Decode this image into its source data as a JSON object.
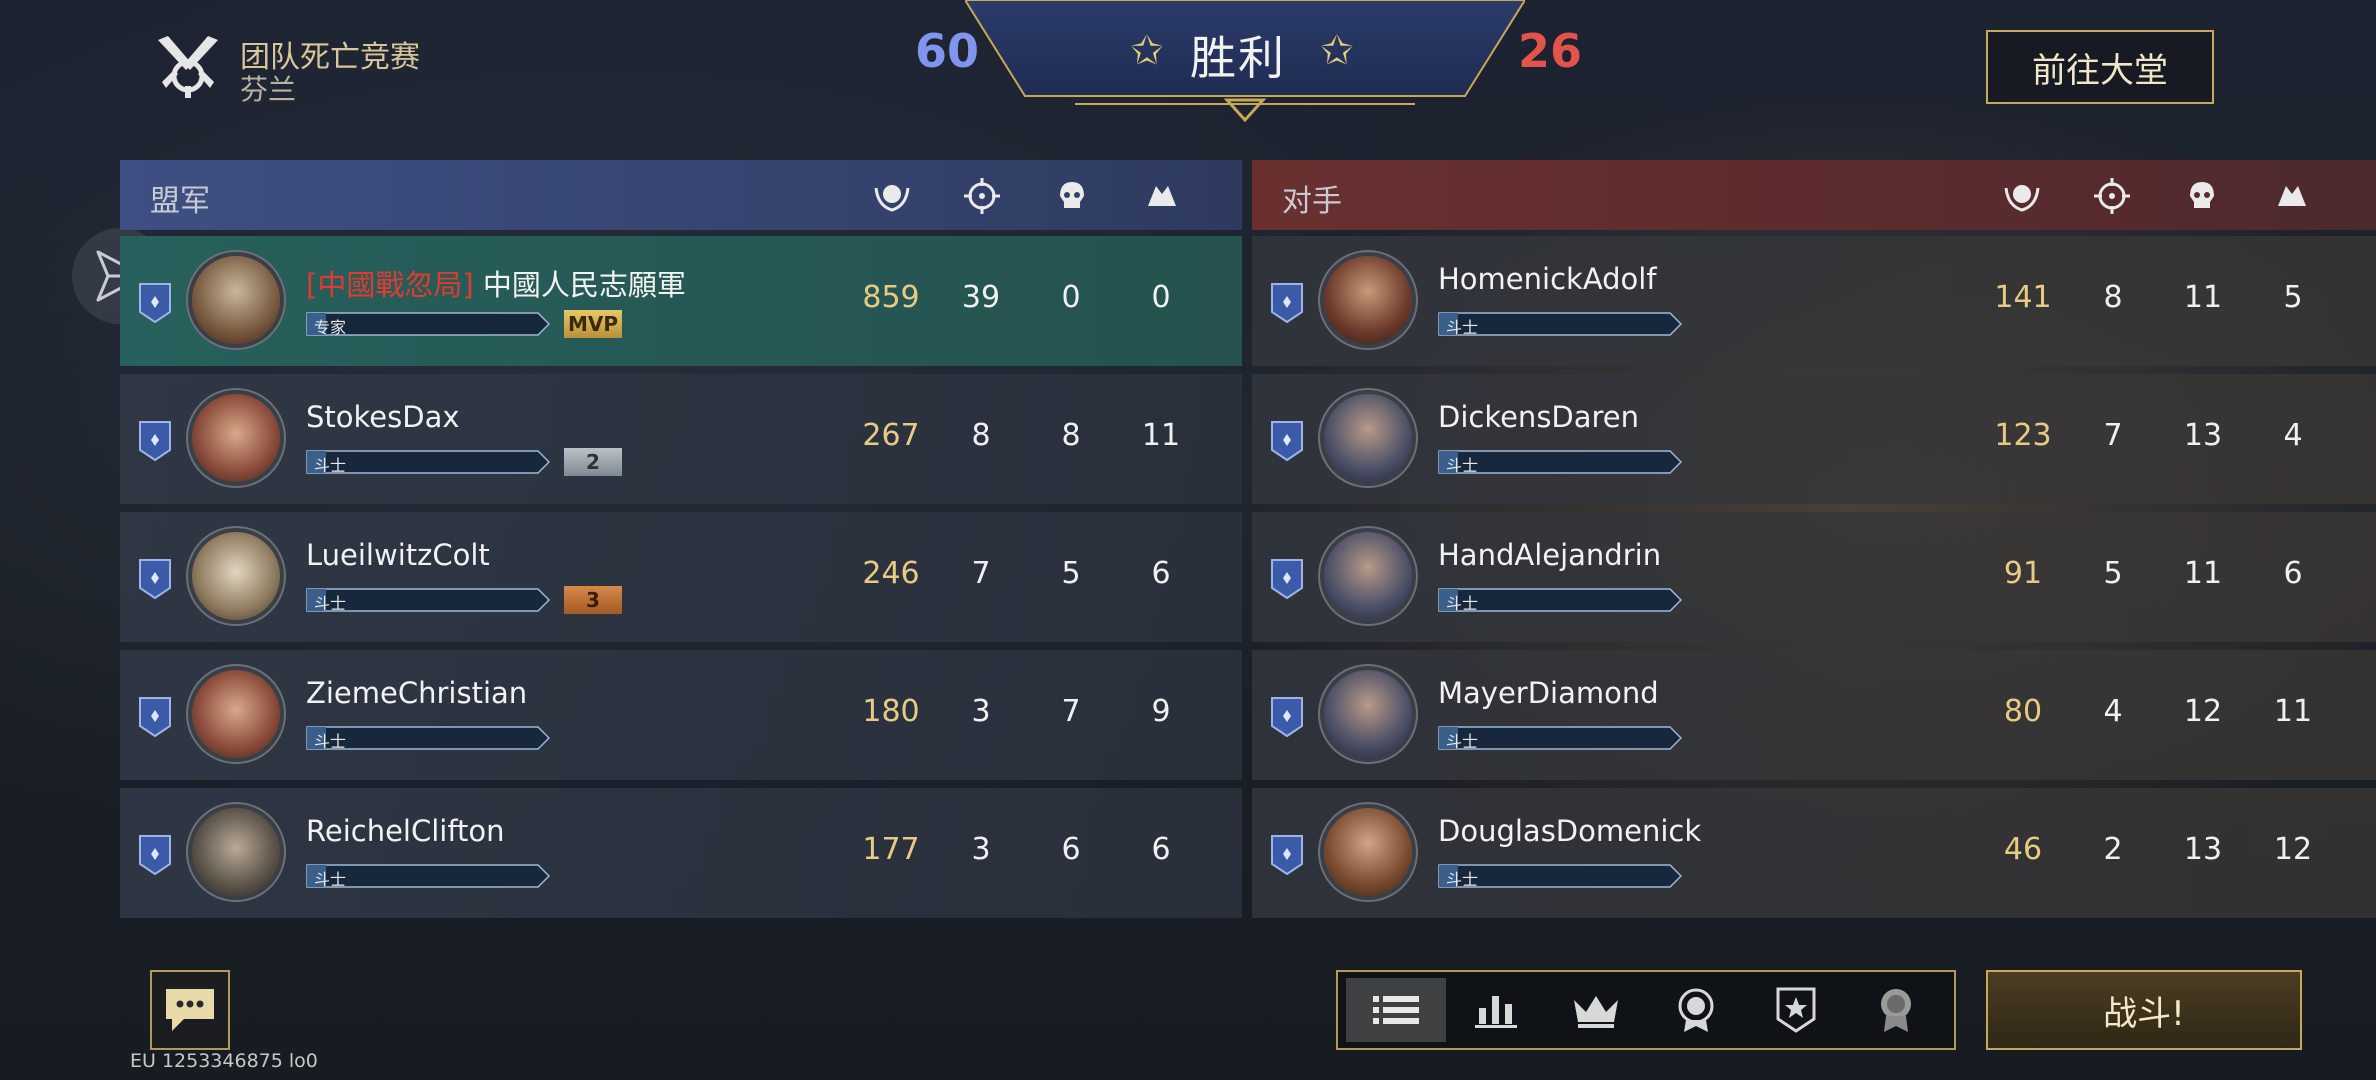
{
  "mode": {
    "title": "团队死亡竞赛",
    "map": "芬兰"
  },
  "result": {
    "label": "胜利",
    "ally_score": "60",
    "enemy_score": "26"
  },
  "buttons": {
    "lobby": "前往大堂",
    "battle": "战斗!"
  },
  "server_id": "EU 1253346875 lo0",
  "colors": {
    "ally_score": "#7f95ee",
    "enemy_score": "#e0544c",
    "gold": "#c6a858",
    "mvp_row": "#27605c"
  },
  "columns": [
    "score-laurel-icon",
    "crosshair-kills-icon",
    "skull-deaths-icon",
    "hands-assists-icon"
  ],
  "allies": {
    "label": "盟军",
    "players": [
      {
        "tag": "[中國戰忽局]",
        "name": "中國人民志願軍",
        "rank": "专家",
        "place": "MVP",
        "score": "859",
        "kills": "39",
        "deaths": "0",
        "assists": "0"
      },
      {
        "tag": "",
        "name": "StokesDax",
        "rank": "斗士",
        "place": "2",
        "score": "267",
        "kills": "8",
        "deaths": "8",
        "assists": "11"
      },
      {
        "tag": "",
        "name": "LueilwitzColt",
        "rank": "斗士",
        "place": "3",
        "score": "246",
        "kills": "7",
        "deaths": "5",
        "assists": "6"
      },
      {
        "tag": "",
        "name": "ZiemeChristian",
        "rank": "斗士",
        "place": "",
        "score": "180",
        "kills": "3",
        "deaths": "7",
        "assists": "9"
      },
      {
        "tag": "",
        "name": "ReichelClifton",
        "rank": "斗士",
        "place": "",
        "score": "177",
        "kills": "3",
        "deaths": "6",
        "assists": "6"
      }
    ]
  },
  "enemies": {
    "label": "对手",
    "players": [
      {
        "name": "HomenickAdolf",
        "rank": "斗士",
        "score": "141",
        "kills": "8",
        "deaths": "11",
        "assists": "5"
      },
      {
        "name": "DickensDaren",
        "rank": "斗士",
        "score": "123",
        "kills": "7",
        "deaths": "13",
        "assists": "4"
      },
      {
        "name": "HandAlejandrin",
        "rank": "斗士",
        "score": "91",
        "kills": "5",
        "deaths": "11",
        "assists": "6"
      },
      {
        "name": "MayerDiamond",
        "rank": "斗士",
        "score": "80",
        "kills": "4",
        "deaths": "12",
        "assists": "11"
      },
      {
        "name": "DouglasDomenick",
        "rank": "斗士",
        "score": "46",
        "kills": "2",
        "deaths": "13",
        "assists": "12"
      }
    ]
  },
  "view_tabs": [
    "list-icon",
    "bar-chart-icon",
    "crown-icon",
    "medal-icon",
    "star-shield-icon",
    "award-icon"
  ]
}
